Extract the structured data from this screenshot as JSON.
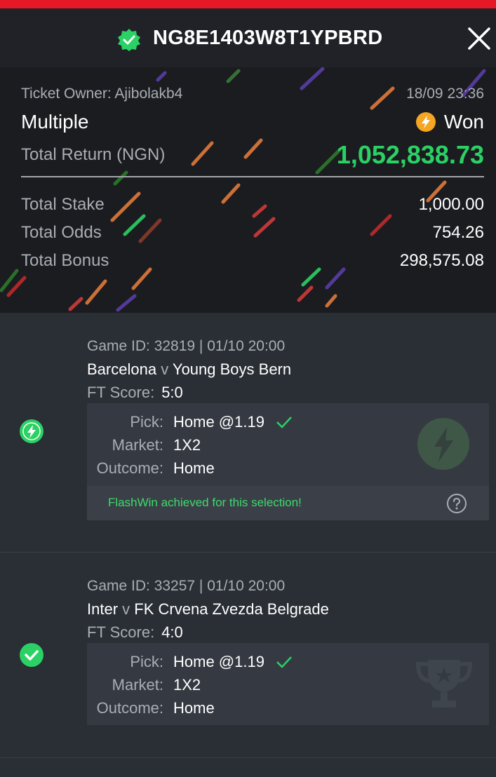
{
  "header": {
    "ticket_id": "NG8E1403W8T1YPBRD"
  },
  "summary": {
    "owner_label": "Ticket Owner: Ajibolakb4",
    "datetime": "18/09 23:36",
    "bet_type": "Multiple",
    "status": "Won",
    "total_return_label": "Total Return (NGN)",
    "total_return_value": "1,052,838.73",
    "stats": [
      {
        "label": "Total Stake",
        "value": "1,000.00"
      },
      {
        "label": "Total Odds",
        "value": "754.26"
      },
      {
        "label": "Total Bonus",
        "value": "298,575.08"
      }
    ]
  },
  "selections": [
    {
      "meta": "Game ID: 32819 | 01/10 20:00",
      "home": "Barcelona",
      "vs": "v",
      "away": "Young Boys Bern",
      "score_label": "FT Score:",
      "score": "5:0",
      "pick_label": "Pick:",
      "pick": "Home @1.19",
      "market_label": "Market:",
      "market": "1X2",
      "outcome_label": "Outcome:",
      "outcome": "Home",
      "flash_message": "FlashWin achieved for this selection!"
    },
    {
      "meta": "Game ID: 33257 | 01/10 20:00",
      "home": "Inter",
      "vs": "v",
      "away": "FK Crvena Zvezda Belgrade",
      "score_label": "FT Score:",
      "score": "4:0",
      "pick_label": "Pick:",
      "pick": "Home @1.19",
      "market_label": "Market:",
      "market": "1X2",
      "outcome_label": "Outcome:",
      "outcome": "Home"
    }
  ],
  "colors": {
    "accent_red": "#e41827",
    "won_green": "#2bd164",
    "bolt_orange": "#f5a623",
    "flash_text": "#3ddb6c"
  },
  "icons": [
    "verified-icon",
    "close-icon",
    "lightning-icon",
    "check-icon",
    "help-icon",
    "trophy-icon"
  ]
}
